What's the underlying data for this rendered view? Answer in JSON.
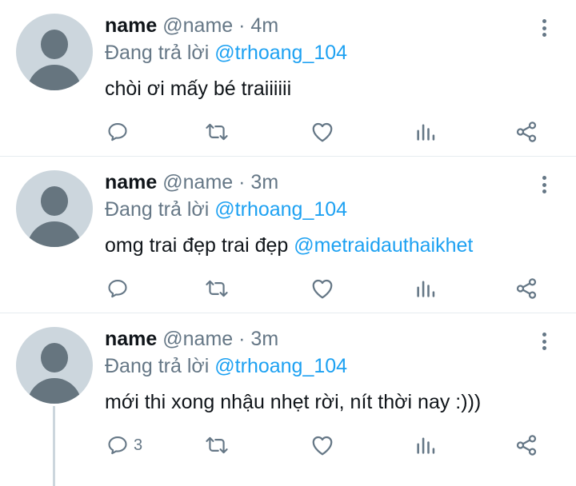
{
  "tweets": [
    {
      "name": "name",
      "handle": "@name",
      "separator": "·",
      "time": "4m",
      "reply_prefix": "Đang trả lời",
      "reply_to": "@trhoang_104",
      "text": "chòi ơi mấy bé traiiiiii",
      "text_mention": "",
      "reply_count": ""
    },
    {
      "name": "name",
      "handle": "@name",
      "separator": "·",
      "time": "3m",
      "reply_prefix": "Đang trả lời",
      "reply_to": "@trhoang_104",
      "text": "omg trai đẹp trai đẹp",
      "text_mention": "@metraidauthaikhet",
      "reply_count": ""
    },
    {
      "name": "name",
      "handle": "@name",
      "separator": "·",
      "time": "3m",
      "reply_prefix": "Đang trả lời",
      "reply_to": "@trhoang_104",
      "text": "mới thi xong nhậu nhẹt rời, nít thời nay :)))",
      "text_mention": "",
      "reply_count": "3"
    }
  ],
  "icons": {
    "reply": "reply-icon",
    "retweet": "retweet-icon",
    "like": "heart-icon",
    "stats": "stats-icon",
    "share": "share-icon",
    "more": "more-vertical-icon",
    "avatar": "default-avatar-icon"
  },
  "colors": {
    "accent": "#1da1f2",
    "secondary_text": "#657786",
    "avatar_bg": "#ccd6dd",
    "divider": "#e6ecf0"
  }
}
